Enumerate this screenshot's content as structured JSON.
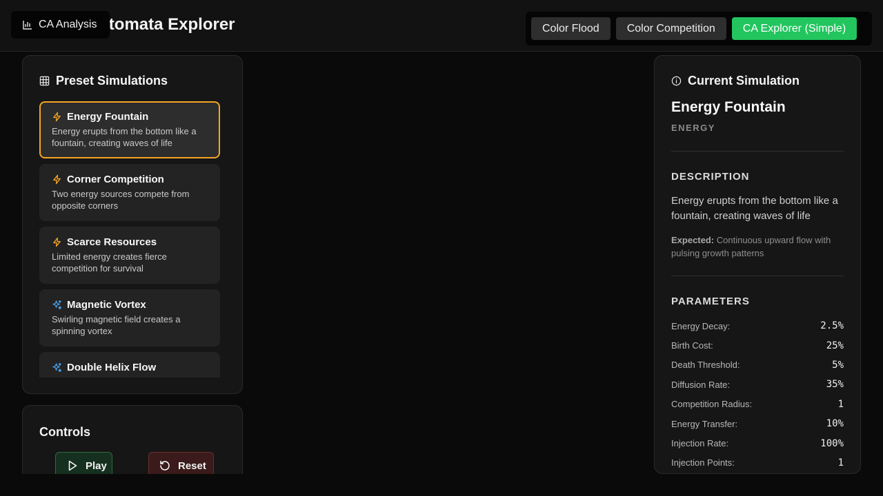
{
  "header": {
    "app_title": "Cellular Automata Explorer",
    "analysis_button": "CA Analysis",
    "modes": [
      {
        "label": "Color Flood",
        "active": false
      },
      {
        "label": "Color Competition",
        "active": false
      },
      {
        "label": "CA Explorer (Simple)",
        "active": true
      }
    ],
    "active_color": "#22c55e"
  },
  "presets": {
    "title": "Preset Simulations",
    "items": [
      {
        "name": "Energy Fountain",
        "description": "Energy erupts from the bottom like a fountain, creating waves of life",
        "icon": "lightning-icon",
        "selected": true
      },
      {
        "name": "Corner Competition",
        "description": "Two energy sources compete from opposite corners",
        "icon": "lightning-icon",
        "selected": false
      },
      {
        "name": "Scarce Resources",
        "description": "Limited energy creates fierce competition for survival",
        "icon": "lightning-icon",
        "selected": false
      },
      {
        "name": "Magnetic Vortex",
        "description": "Swirling magnetic field creates a spinning vortex",
        "icon": "sparkles-icon",
        "selected": false
      },
      {
        "name": "Double Helix Flow",
        "description": "",
        "icon": "sparkles-icon",
        "selected": false
      }
    ],
    "selected_border_color": "#f5a524"
  },
  "controls": {
    "title": "Controls",
    "play_label": "Play",
    "reset_label": "Reset"
  },
  "current": {
    "title": "Current Simulation",
    "name": "Energy Fountain",
    "category": "ENERGY",
    "description_label": "DESCRIPTION",
    "description": "Energy erupts from the bottom like a fountain, creating waves of life",
    "expected_label": "Expected:",
    "expected": "Continuous upward flow with pulsing growth patterns",
    "parameters_label": "PARAMETERS",
    "parameters": [
      {
        "label": "Energy Decay:",
        "value": "2.5%"
      },
      {
        "label": "Birth Cost:",
        "value": "25%"
      },
      {
        "label": "Death Threshold:",
        "value": "5%"
      },
      {
        "label": "Diffusion Rate:",
        "value": "35%"
      },
      {
        "label": "Competition Radius:",
        "value": "1"
      },
      {
        "label": "Energy Transfer:",
        "value": "10%"
      },
      {
        "label": "Injection Rate:",
        "value": "100%"
      },
      {
        "label": "Injection Points:",
        "value": "1"
      }
    ]
  }
}
